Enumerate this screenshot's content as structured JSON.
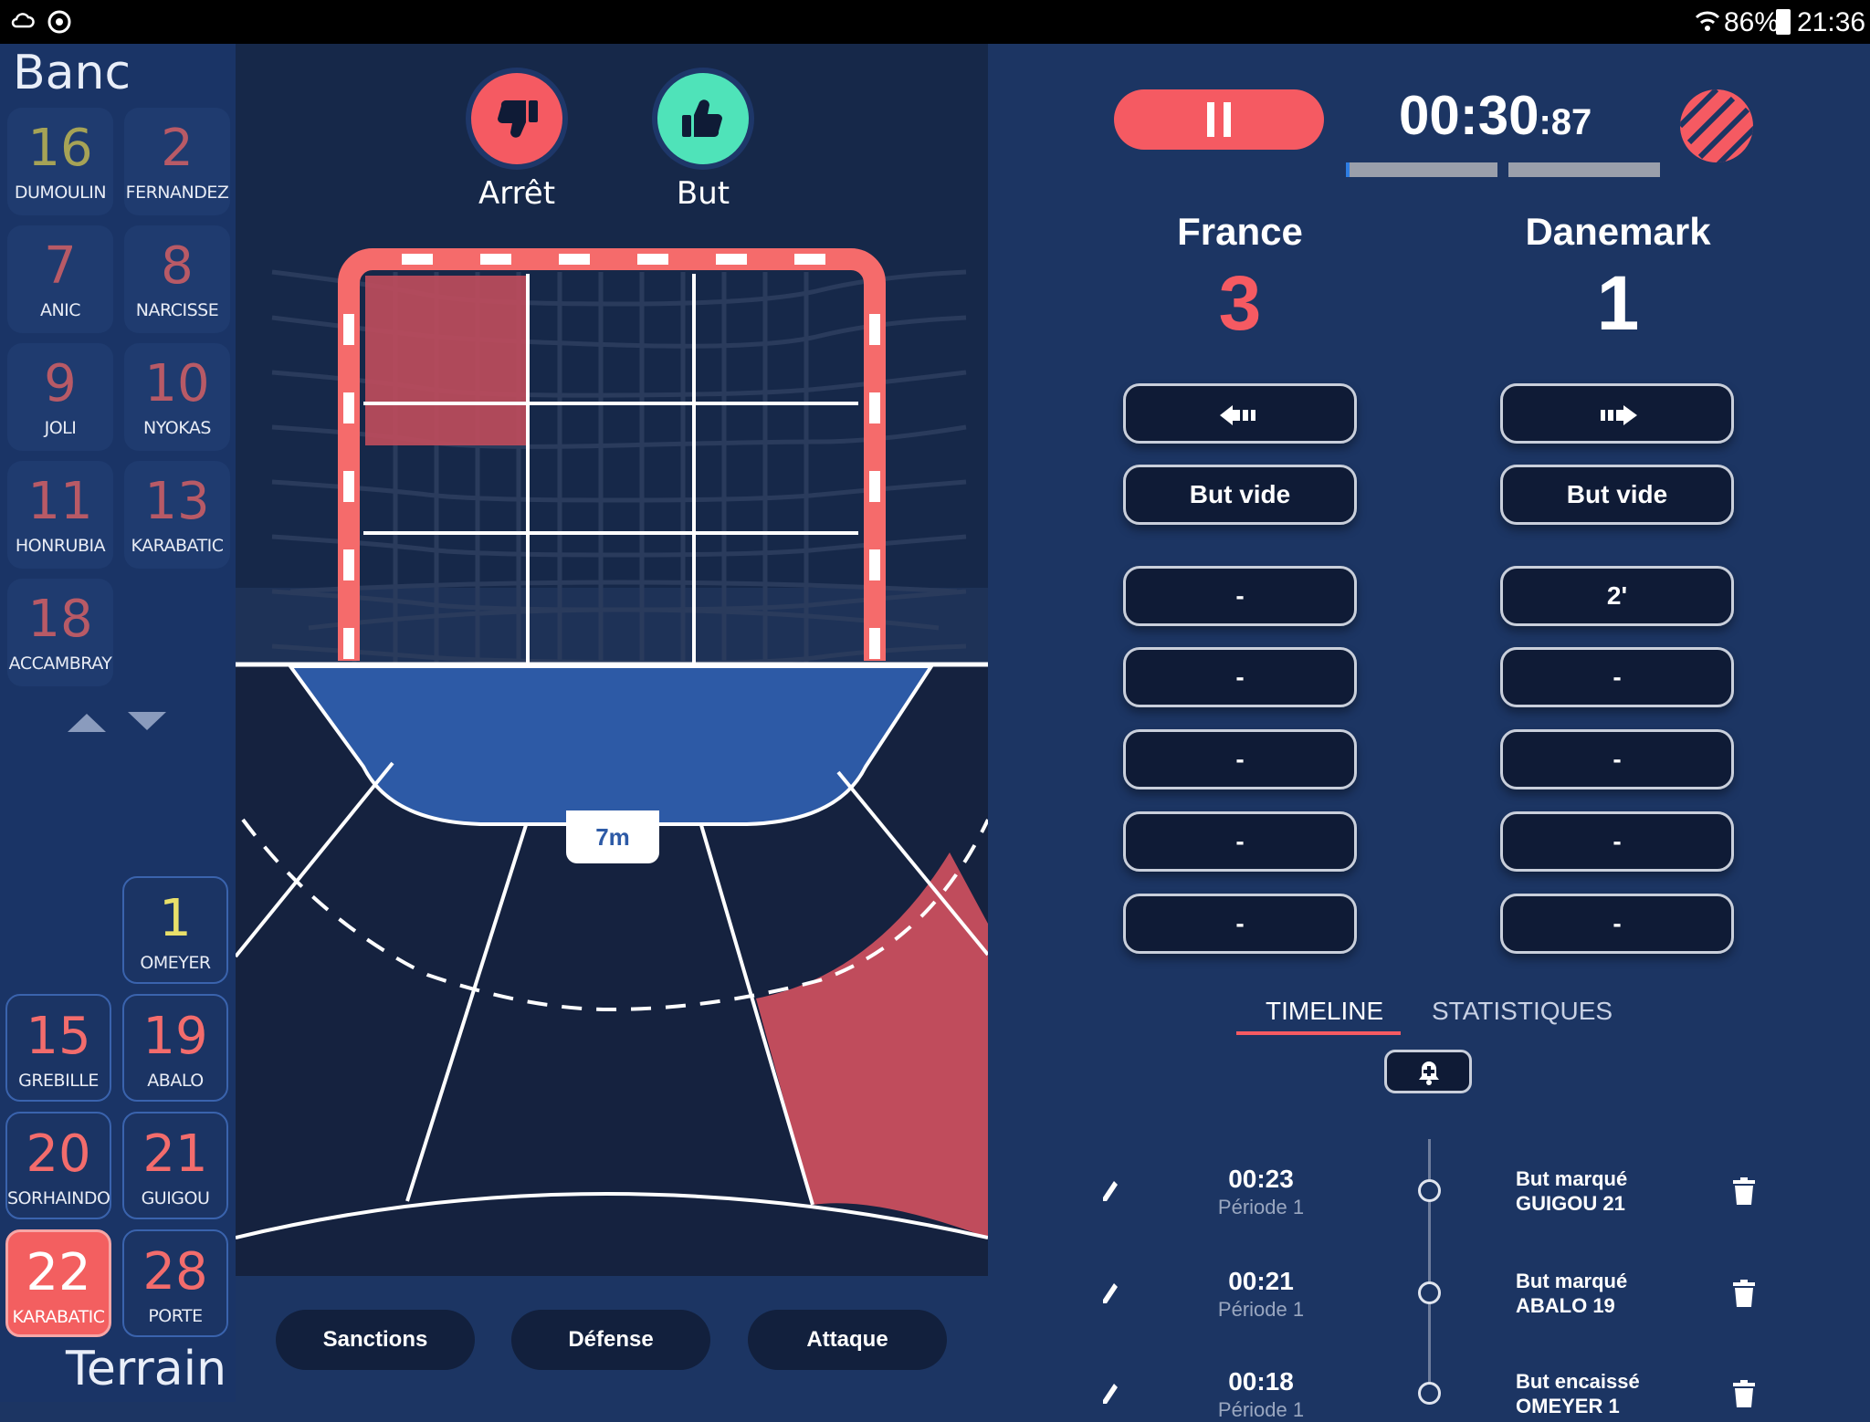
{
  "status_bar": {
    "battery": "86%",
    "time": "21:36"
  },
  "bench": {
    "title": "Banc",
    "players": [
      {
        "number": "16",
        "name": "DUMOULIN"
      },
      {
        "number": "2",
        "name": "FERNANDEZ"
      },
      {
        "number": "7",
        "name": "ANIC"
      },
      {
        "number": "8",
        "name": "NARCISSE"
      },
      {
        "number": "9",
        "name": "JOLI"
      },
      {
        "number": "10",
        "name": "NYOKAS"
      },
      {
        "number": "11",
        "name": "HONRUBIA"
      },
      {
        "number": "13",
        "name": "KARABATIC"
      },
      {
        "number": "18",
        "name": "ACCAMBRAY"
      }
    ]
  },
  "court": {
    "title": "Terrain",
    "players": [
      {
        "number": "1",
        "name": "OMEYER"
      },
      {
        "number": "15",
        "name": "GREBILLE"
      },
      {
        "number": "19",
        "name": "ABALO"
      },
      {
        "number": "20",
        "name": "SORHAINDO"
      },
      {
        "number": "21",
        "name": "GUIGOU"
      },
      {
        "number": "22",
        "name": "KARABATIC"
      },
      {
        "number": "28",
        "name": "PORTE"
      }
    ]
  },
  "actions": {
    "stop_label": "Arrêt",
    "goal_label": "But"
  },
  "field": {
    "seven_m_label": "7m"
  },
  "bottom_buttons": {
    "sanctions": "Sanctions",
    "defense": "Défense",
    "attack": "Attaque"
  },
  "timer": {
    "main": "00:30",
    "fraction": ":87"
  },
  "teams": {
    "home": {
      "name": "France",
      "score": "3",
      "empty_goal": "But vide",
      "penalties": [
        "-",
        "-",
        "-",
        "-",
        "-"
      ]
    },
    "away": {
      "name": "Danemark",
      "score": "1",
      "empty_goal": "But vide",
      "penalties": [
        "2'",
        "-",
        "-",
        "-",
        "-"
      ]
    }
  },
  "tabs": {
    "timeline": "TIMELINE",
    "stats": "STATISTIQUES"
  },
  "timeline": [
    {
      "time": "00:23",
      "period": "Période 1",
      "event": "But marqué",
      "player": "GUIGOU 21"
    },
    {
      "time": "00:21",
      "period": "Période 1",
      "event": "But marqué",
      "player": "ABALO 19"
    },
    {
      "time": "00:18",
      "period": "Période 1",
      "event": "But encaissé",
      "player": "OMEYER 1"
    }
  ],
  "colors": {
    "accent_red": "#f55a62",
    "accent_green": "#4fe3b9",
    "score_red": "#f55a62",
    "panel_blue": "#1c3563"
  }
}
